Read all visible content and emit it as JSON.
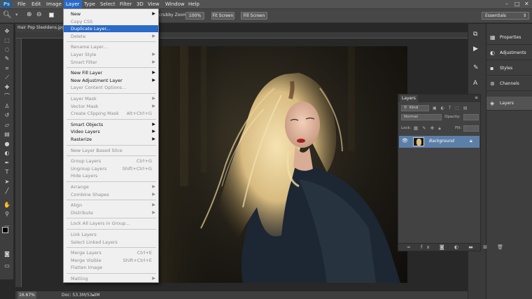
{
  "menubar": {
    "logo": "Ps",
    "items": [
      "File",
      "Edit",
      "Image",
      "Layer",
      "Type",
      "Select",
      "Filter",
      "3D",
      "View",
      "Window",
      "Help"
    ],
    "active": "Layer"
  },
  "options": {
    "scrubby_zoom": "crubby Zoom",
    "btn_100": "100%",
    "btn_fit": "Fit Screen",
    "btn_fill": "Fill Screen",
    "workspace": "Essentials"
  },
  "document": {
    "tab_title": "Hair Pop Sleeldens.jpg",
    "zoom": "16.67%",
    "doc_size": "Doc: 53.3M/53.3M"
  },
  "layer_menu": {
    "items": [
      {
        "label": "New",
        "arrow": true
      },
      {
        "label": "Copy CSS",
        "disabled": true
      },
      {
        "label": "Duplicate Layer...",
        "highlight": true
      },
      {
        "label": "Delete",
        "arrow": true,
        "disabled": true
      },
      {
        "sep": true
      },
      {
        "label": "Rename Layer...",
        "disabled": true
      },
      {
        "label": "Layer Style",
        "arrow": true,
        "disabled": true
      },
      {
        "label": "Smart Filter",
        "arrow": true,
        "disabled": true
      },
      {
        "sep": true
      },
      {
        "label": "New Fill Layer",
        "arrow": true
      },
      {
        "label": "New Adjustment Layer",
        "arrow": true
      },
      {
        "label": "Layer Content Options...",
        "disabled": true
      },
      {
        "sep": true
      },
      {
        "label": "Layer Mask",
        "arrow": true,
        "disabled": true
      },
      {
        "label": "Vector Mask",
        "arrow": true,
        "disabled": true
      },
      {
        "label": "Create Clipping Mask",
        "shortcut": "Alt+Ctrl+G",
        "disabled": true
      },
      {
        "sep": true
      },
      {
        "label": "Smart Objects",
        "arrow": true
      },
      {
        "label": "Video Layers",
        "arrow": true
      },
      {
        "label": "Rasterize",
        "arrow": true
      },
      {
        "sep": true
      },
      {
        "label": "New Layer Based Slice",
        "disabled": true
      },
      {
        "sep": true
      },
      {
        "label": "Group Layers",
        "shortcut": "Ctrl+G",
        "disabled": true
      },
      {
        "label": "Ungroup Layers",
        "shortcut": "Shift+Ctrl+G",
        "disabled": true
      },
      {
        "label": "Hide Layers",
        "disabled": true
      },
      {
        "sep": true
      },
      {
        "label": "Arrange",
        "arrow": true,
        "disabled": true
      },
      {
        "label": "Combine Shapes",
        "arrow": true,
        "disabled": true
      },
      {
        "sep": true
      },
      {
        "label": "Align",
        "arrow": true,
        "disabled": true
      },
      {
        "label": "Distribute",
        "arrow": true,
        "disabled": true
      },
      {
        "sep": true
      },
      {
        "label": "Lock All Layers in Group...",
        "disabled": true
      },
      {
        "sep": true
      },
      {
        "label": "Link Layers",
        "disabled": true
      },
      {
        "label": "Select Linked Layers",
        "disabled": true
      },
      {
        "sep": true
      },
      {
        "label": "Merge Layers",
        "shortcut": "Ctrl+E",
        "disabled": true
      },
      {
        "label": "Merge Visible",
        "shortcut": "Shift+Ctrl+E",
        "disabled": true
      },
      {
        "label": "Flatten Image",
        "disabled": true
      },
      {
        "sep": true
      },
      {
        "label": "Matting",
        "arrow": true,
        "disabled": true
      }
    ]
  },
  "right_panel": {
    "items": [
      "Properties",
      "Adjustments",
      "Styles",
      "Channels",
      "Layers"
    ],
    "selected": "Layers"
  },
  "layers_panel": {
    "tab": "Layers",
    "filter": "Kind",
    "blend": "Normal",
    "opacity_label": "Opacity:",
    "lock_label": "Lock:",
    "fill_label": "Fill:",
    "layer_name": "Background"
  }
}
